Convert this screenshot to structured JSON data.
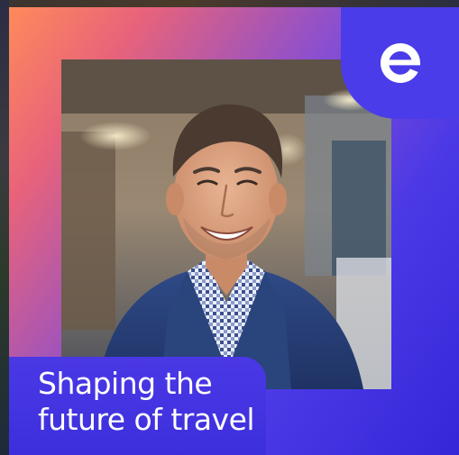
{
  "headline": {
    "line1": "Shaping the",
    "line2": "future of travel"
  },
  "logo": {
    "icon": "expedia-e-logo",
    "color": "#ffffff"
  },
  "colors": {
    "gradient_start": "#ff8a5b",
    "gradient_end": "#3527d8",
    "caption_panel": "#4a38e5"
  }
}
